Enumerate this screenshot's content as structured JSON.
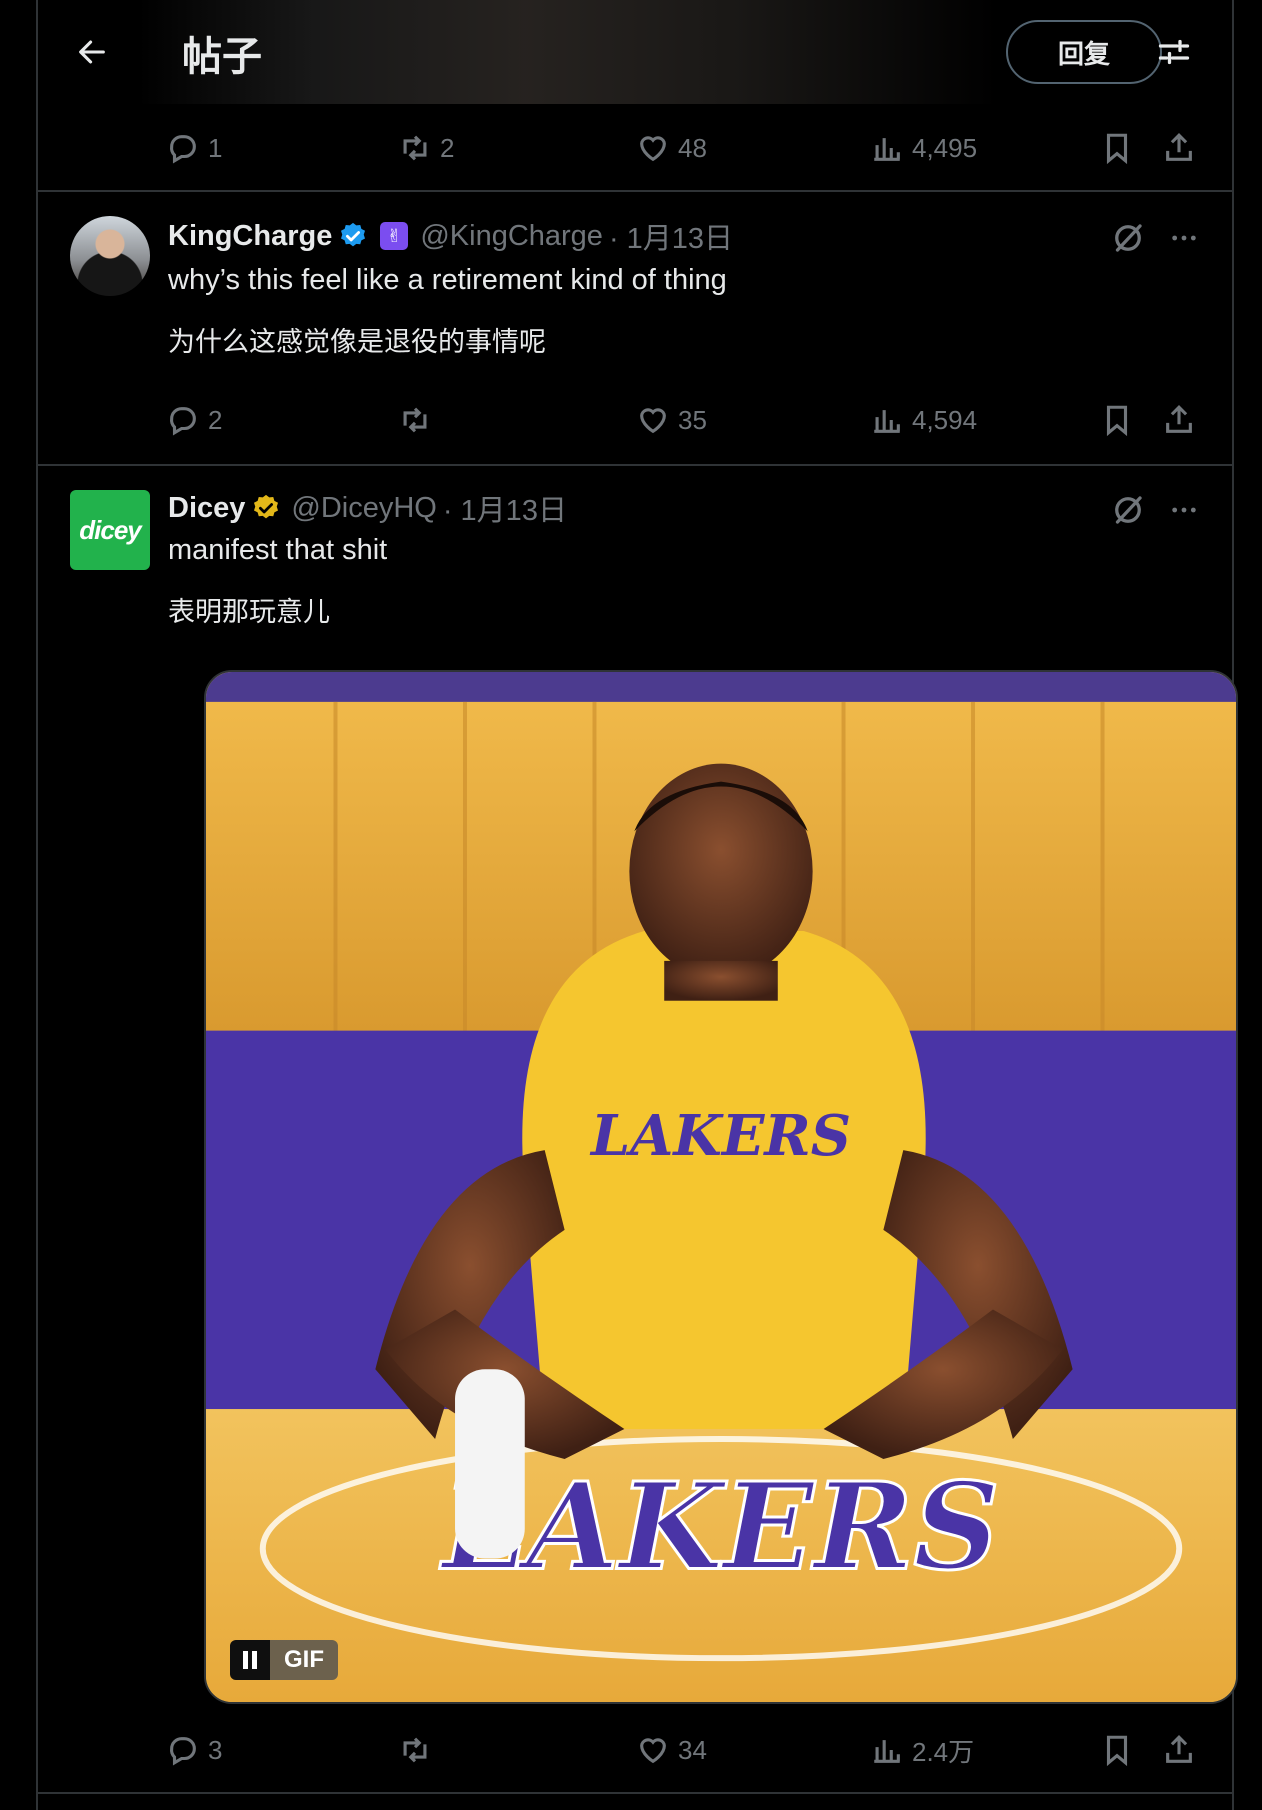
{
  "header": {
    "title": "帖子",
    "reply_label": "回复",
    "back_icon": "arrow-left-icon",
    "filter_icon": "sliders-icon"
  },
  "top_actions": {
    "replies": "1",
    "reposts": "2",
    "likes": "48",
    "views": "4,495"
  },
  "tweets": [
    {
      "display_name": "KingCharge",
      "handle": "@KingCharge",
      "date": "· 1月13日",
      "text": "why’s this feel like a retirement kind of thing",
      "translation": "为什么这感觉像是退役的事情呢",
      "badge": "verified-blue",
      "grok_badge": "✌",
      "actions": {
        "replies": "2",
        "reposts": "",
        "likes": "35",
        "views": "4,594"
      }
    },
    {
      "display_name": "Dicey",
      "handle": "@DiceyHQ",
      "date": "· 1月13日",
      "text": "manifest that shit",
      "translation": "表明那玩意儿",
      "badge": "verified-gold",
      "avatar_text": "dicey",
      "media": {
        "type": "gif",
        "label": "GIF",
        "jersey_text": "LAKERS",
        "floor_text": "LAKERS"
      },
      "actions": {
        "replies": "3",
        "reposts": "",
        "likes": "34",
        "views": "2.4万"
      }
    }
  ],
  "colors": {
    "background": "#000000",
    "text": "#e7e9ea",
    "muted": "#71767b",
    "border": "#2f3336",
    "verified_blue": "#1d9bf0",
    "verified_gold": "#e2b719",
    "dicey_green": "#22b24c"
  }
}
